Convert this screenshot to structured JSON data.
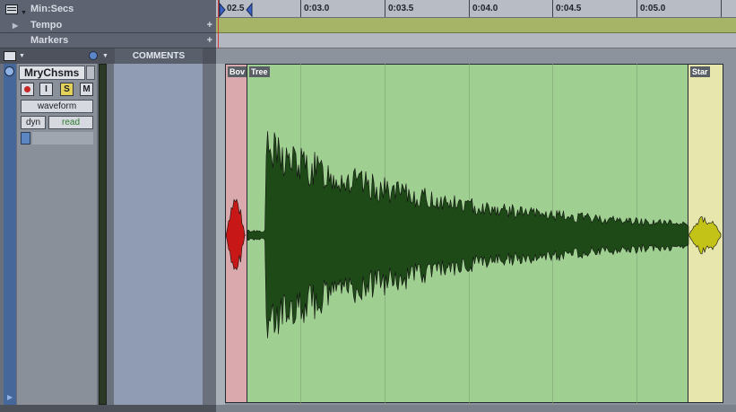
{
  "ruler": {
    "timebase_label": "Min:Secs",
    "ticks": [
      "02.5",
      "0:03.0",
      "0:03.5",
      "0:04.0",
      "0:04.5",
      "0:05.0"
    ]
  },
  "rows": {
    "tempo_label": "Tempo",
    "markers_label": "Markers",
    "plus": "+"
  },
  "header": {
    "comments_label": "COMMENTS"
  },
  "track": {
    "name": "MryChsms",
    "buttons": {
      "input": "I",
      "solo": "S",
      "mute": "M"
    },
    "view": "waveform",
    "dyn": "dyn",
    "automation": "read"
  },
  "clips": [
    {
      "label": "Bov",
      "color": "#d9a9ad",
      "wave_color": "#c81717"
    },
    {
      "label": "Tree",
      "color": "#a0d091",
      "wave_color": "#1e4a18"
    },
    {
      "label": "Star",
      "color": "#e6e6ad",
      "wave_color": "#c3c317"
    }
  ],
  "colors": {
    "tempo_bar": "#a5b466",
    "playhead": "#d13a3a"
  },
  "icons": {
    "menu": "hamburger-icon",
    "clock": "clock-icon",
    "record": "record-icon",
    "play": "play-icon"
  }
}
